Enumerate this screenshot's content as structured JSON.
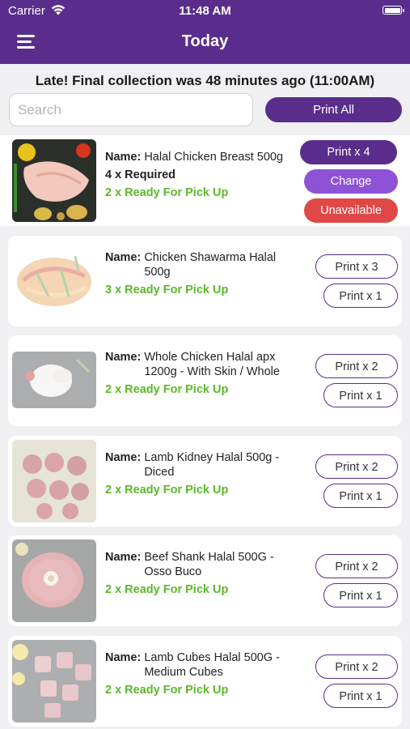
{
  "status_bar": {
    "carrier": "Carrier",
    "time": "11:48 AM"
  },
  "header": {
    "title": "Today",
    "menu_icon": "hamburger-menu-icon"
  },
  "late_message": "Late! Final collection was 48 minutes ago (11:00AM)",
  "search": {
    "placeholder": "Search",
    "value": ""
  },
  "print_all_label": "Print All",
  "colors": {
    "accent": "#5a2d8c",
    "ready_green": "#5cb82a",
    "change_purple": "#8e52d6",
    "unavailable_red": "#e04848"
  },
  "name_label": "Name:",
  "items": [
    {
      "name": "Halal Chicken Breast 500g",
      "required": "4 x Required",
      "ready": "2 x Ready For Pick Up",
      "print_label": "Print x 4",
      "change_label": "Change",
      "unavailable_label": "Unavailable"
    },
    {
      "name": "Chicken Shawarma Halal 500g",
      "ready": "3 x Ready For Pick Up",
      "print_label": "Print x 3",
      "print_one_label": "Print x 1"
    },
    {
      "name": "Whole Chicken Halal apx 1200g - With Skin / Whole",
      "ready": "2 x Ready For Pick Up",
      "print_label": "Print x 2",
      "print_one_label": "Print x 1"
    },
    {
      "name": "Lamb Kidney Halal 500g - Diced",
      "ready": "2 x Ready For Pick Up",
      "print_label": "Print x 2",
      "print_one_label": "Print x 1"
    },
    {
      "name": "Beef Shank Halal 500G - Osso Buco",
      "ready": "2 x Ready For Pick Up",
      "print_label": "Print x 2",
      "print_one_label": "Print x 1"
    },
    {
      "name": "Lamb Cubes Halal 500G - Medium Cubes",
      "ready": "2 x Ready For Pick Up",
      "print_label": "Print x 2",
      "print_one_label": "Print x 1"
    }
  ]
}
